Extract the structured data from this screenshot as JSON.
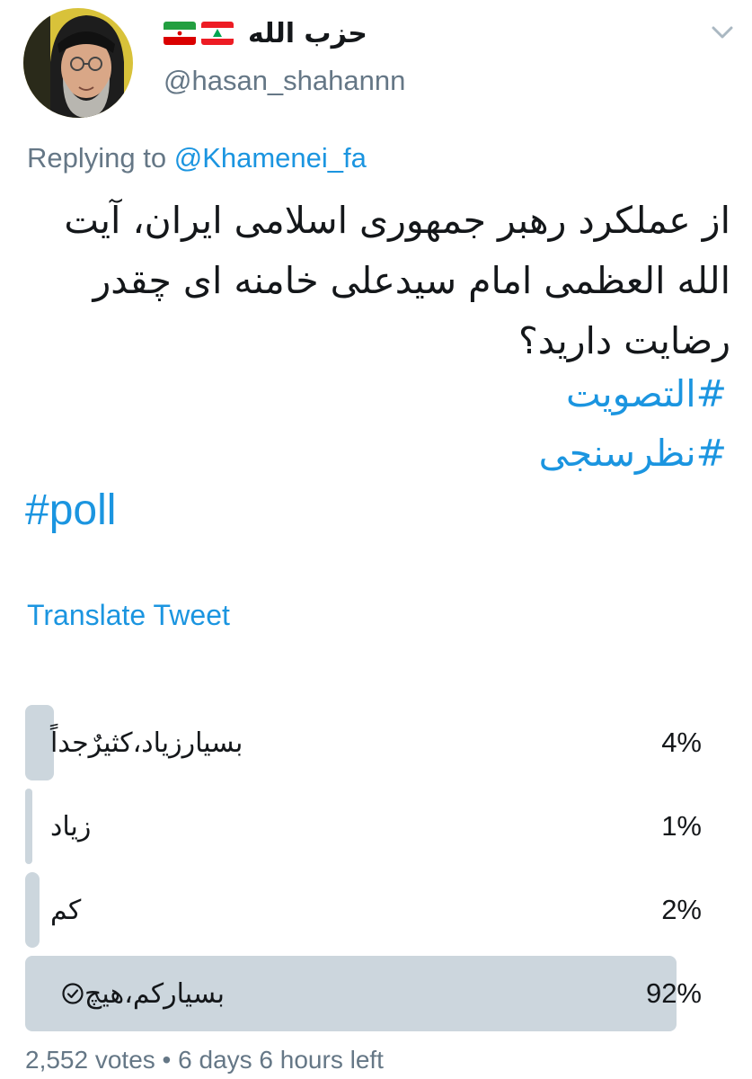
{
  "author": {
    "display_name": "حزب الله",
    "handle": "@hasan_shahannn",
    "flags": [
      "iran-flag",
      "lebanon-flag"
    ]
  },
  "reply": {
    "prefix": "Replying to ",
    "mention": "@Khamenei_fa"
  },
  "tweet": {
    "text": "از عملکرد رهبر جمهوری اسلامی ایران، آیت الله العظمی امام سیدعلی خامنه ای چقدر رضایت دارید؟",
    "hashtags": [
      "#التصويت",
      "#نظرسنجی",
      "#poll"
    ]
  },
  "translate_label": "Translate Tweet",
  "poll": {
    "options": [
      {
        "label": "بسیارزیاد،كثيرٌجداً",
        "percent": 4,
        "percent_label": "4%",
        "selected": false
      },
      {
        "label": "زیاد",
        "percent": 1,
        "percent_label": "1%",
        "selected": false
      },
      {
        "label": "کم",
        "percent": 2,
        "percent_label": "2%",
        "selected": false
      },
      {
        "label": "بسیارکم،هیچ",
        "percent": 92,
        "percent_label": "92%",
        "selected": true
      }
    ],
    "votes": "2,552 votes",
    "separator": " • ",
    "time_left": "6 days 6 hours left"
  },
  "colors": {
    "link": "#1b95e0",
    "muted": "#657786",
    "bar": "#ccd6dd",
    "text": "#14171a"
  },
  "icons": {
    "menu": "chevron-down-icon",
    "selected": "checkmark-circle-icon"
  }
}
